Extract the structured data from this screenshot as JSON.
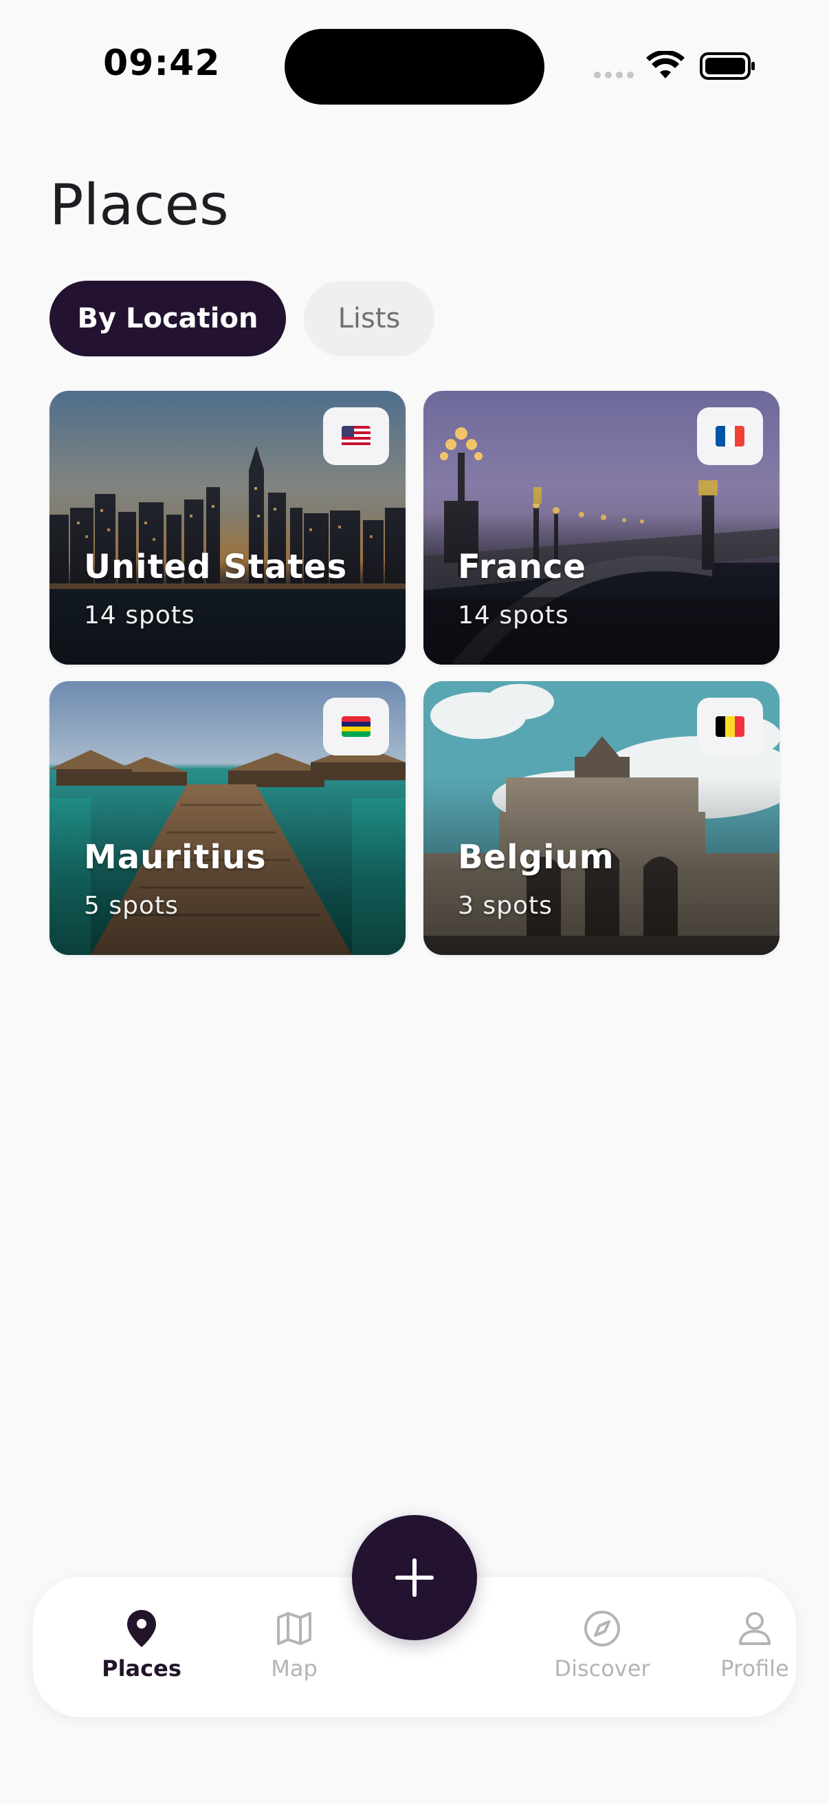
{
  "status_bar": {
    "time": "09:42"
  },
  "header": {
    "title": "Places"
  },
  "tabs": [
    {
      "label": "By Location",
      "active": true
    },
    {
      "label": "Lists",
      "active": false
    }
  ],
  "places": [
    {
      "name": "United States",
      "count": "14 spots",
      "flag": "us-flag"
    },
    {
      "name": "France",
      "count": "14 spots",
      "flag": "fr-flag"
    },
    {
      "name": "Mauritius",
      "count": "5 spots",
      "flag": "mu-flag"
    },
    {
      "name": "Belgium",
      "count": "3 spots",
      "flag": "be-flag"
    }
  ],
  "nav": {
    "items": [
      {
        "label": "Places",
        "icon": "pin-icon",
        "active": true
      },
      {
        "label": "Map",
        "icon": "map-icon",
        "active": false
      },
      {
        "label": "Discover",
        "icon": "compass-icon",
        "active": false
      },
      {
        "label": "Profile",
        "icon": "person-icon",
        "active": false
      }
    ],
    "add_icon": "plus-icon"
  },
  "colors": {
    "primary": "#241330",
    "background": "#f9f9fa",
    "inactive_tab": "#efefef",
    "nav_inactive": "#b4b4b8"
  }
}
